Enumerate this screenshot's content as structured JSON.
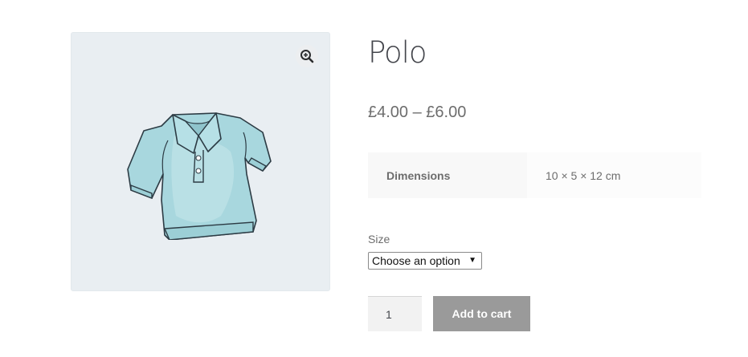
{
  "product": {
    "title": "Polo",
    "price": "£4.00 – £6.00",
    "image_icon": "polo-shirt-image",
    "zoom_icon": "magnifier-plus-icon"
  },
  "attributes": {
    "label": "Dimensions",
    "value": "10 × 5 × 12 cm"
  },
  "variation": {
    "label": "Size",
    "selected": "Choose an option"
  },
  "cart": {
    "quantity": "1",
    "button_label": "Add to cart"
  },
  "colors": {
    "gallery_bg": "#e9eef2",
    "button_bg": "#9a9a9a",
    "title": "#43454b",
    "text": "#6d6d6d"
  }
}
